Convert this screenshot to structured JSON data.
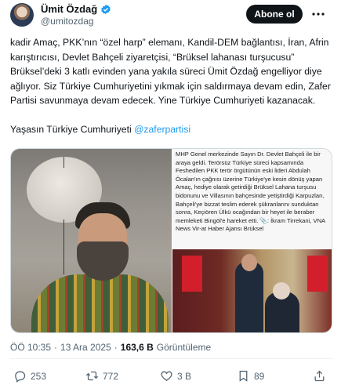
{
  "author": {
    "display_name": "Ümit Özdağ",
    "handle": "@umitozdag"
  },
  "header": {
    "follow_label": "Abone ol"
  },
  "tweet": {
    "paragraph1": "kadir Amaç, PKK’nın “özel harp” elemanı, Kandil-DEM bağlantısı, İran, Afrin karıştırıcısı, Devlet Bahçeli ziyaretçisi, “Brüksel lahanası turşucusu” Brüksel’deki  3 katlı evinden yana yakıla süreci Ümit Özdağ engelliyor diye ağlıyor. Siz Türkiye Cumhuriyetini yıkmak için saldırmaya devam edin, Zafer Partisi savunmaya devam edecek. Yine Türkiye Cumhuriyeti kazanacak.",
    "paragraph2_text": "Yaşasın Türkiye Cumhuriyeti",
    "paragraph2_mention": "@zaferpartisi"
  },
  "media": {
    "caption": "MHP Genel merkezinde Sayın Dr. Devlet Bahçeli ile bir araya geldi. Terörsüz Türkiye süreci kapsamında Feshedilen PKK terör örgütünün eski lideri Abdulah Öcalan'ın çağnısı üzerine Türkiye'ye kesin dönüş yapan Amaç, hediye olarak getirdiği Brüksel Lahana turşusu bidonunu ve Villasının bahçesinde yetiştirdiği Karpuzları, Bahçeli'ye bizzat teslim ederek şükranlarını sunduktan sonra, Keçiören Ülkü ocağından bir heyet ile beraber memleketi Bingöl'e hareket etti. 📎: İkram Tirrekani, VNA News Vir-at Haber Ajansı Brüksel"
  },
  "meta": {
    "time": "ÖÖ 10:35",
    "separator1": "·",
    "date": "13 Ara 2025",
    "separator2": "·",
    "views_count": "163,6 B",
    "views_label": "Görüntüleme"
  },
  "actions": {
    "replies": "253",
    "retweets": "772",
    "likes": "3 B",
    "bookmarks": "89"
  },
  "colors": {
    "accent": "#1d9bf0",
    "text": "#0f1419",
    "muted": "#536471",
    "button_bg": "#0f1419"
  }
}
